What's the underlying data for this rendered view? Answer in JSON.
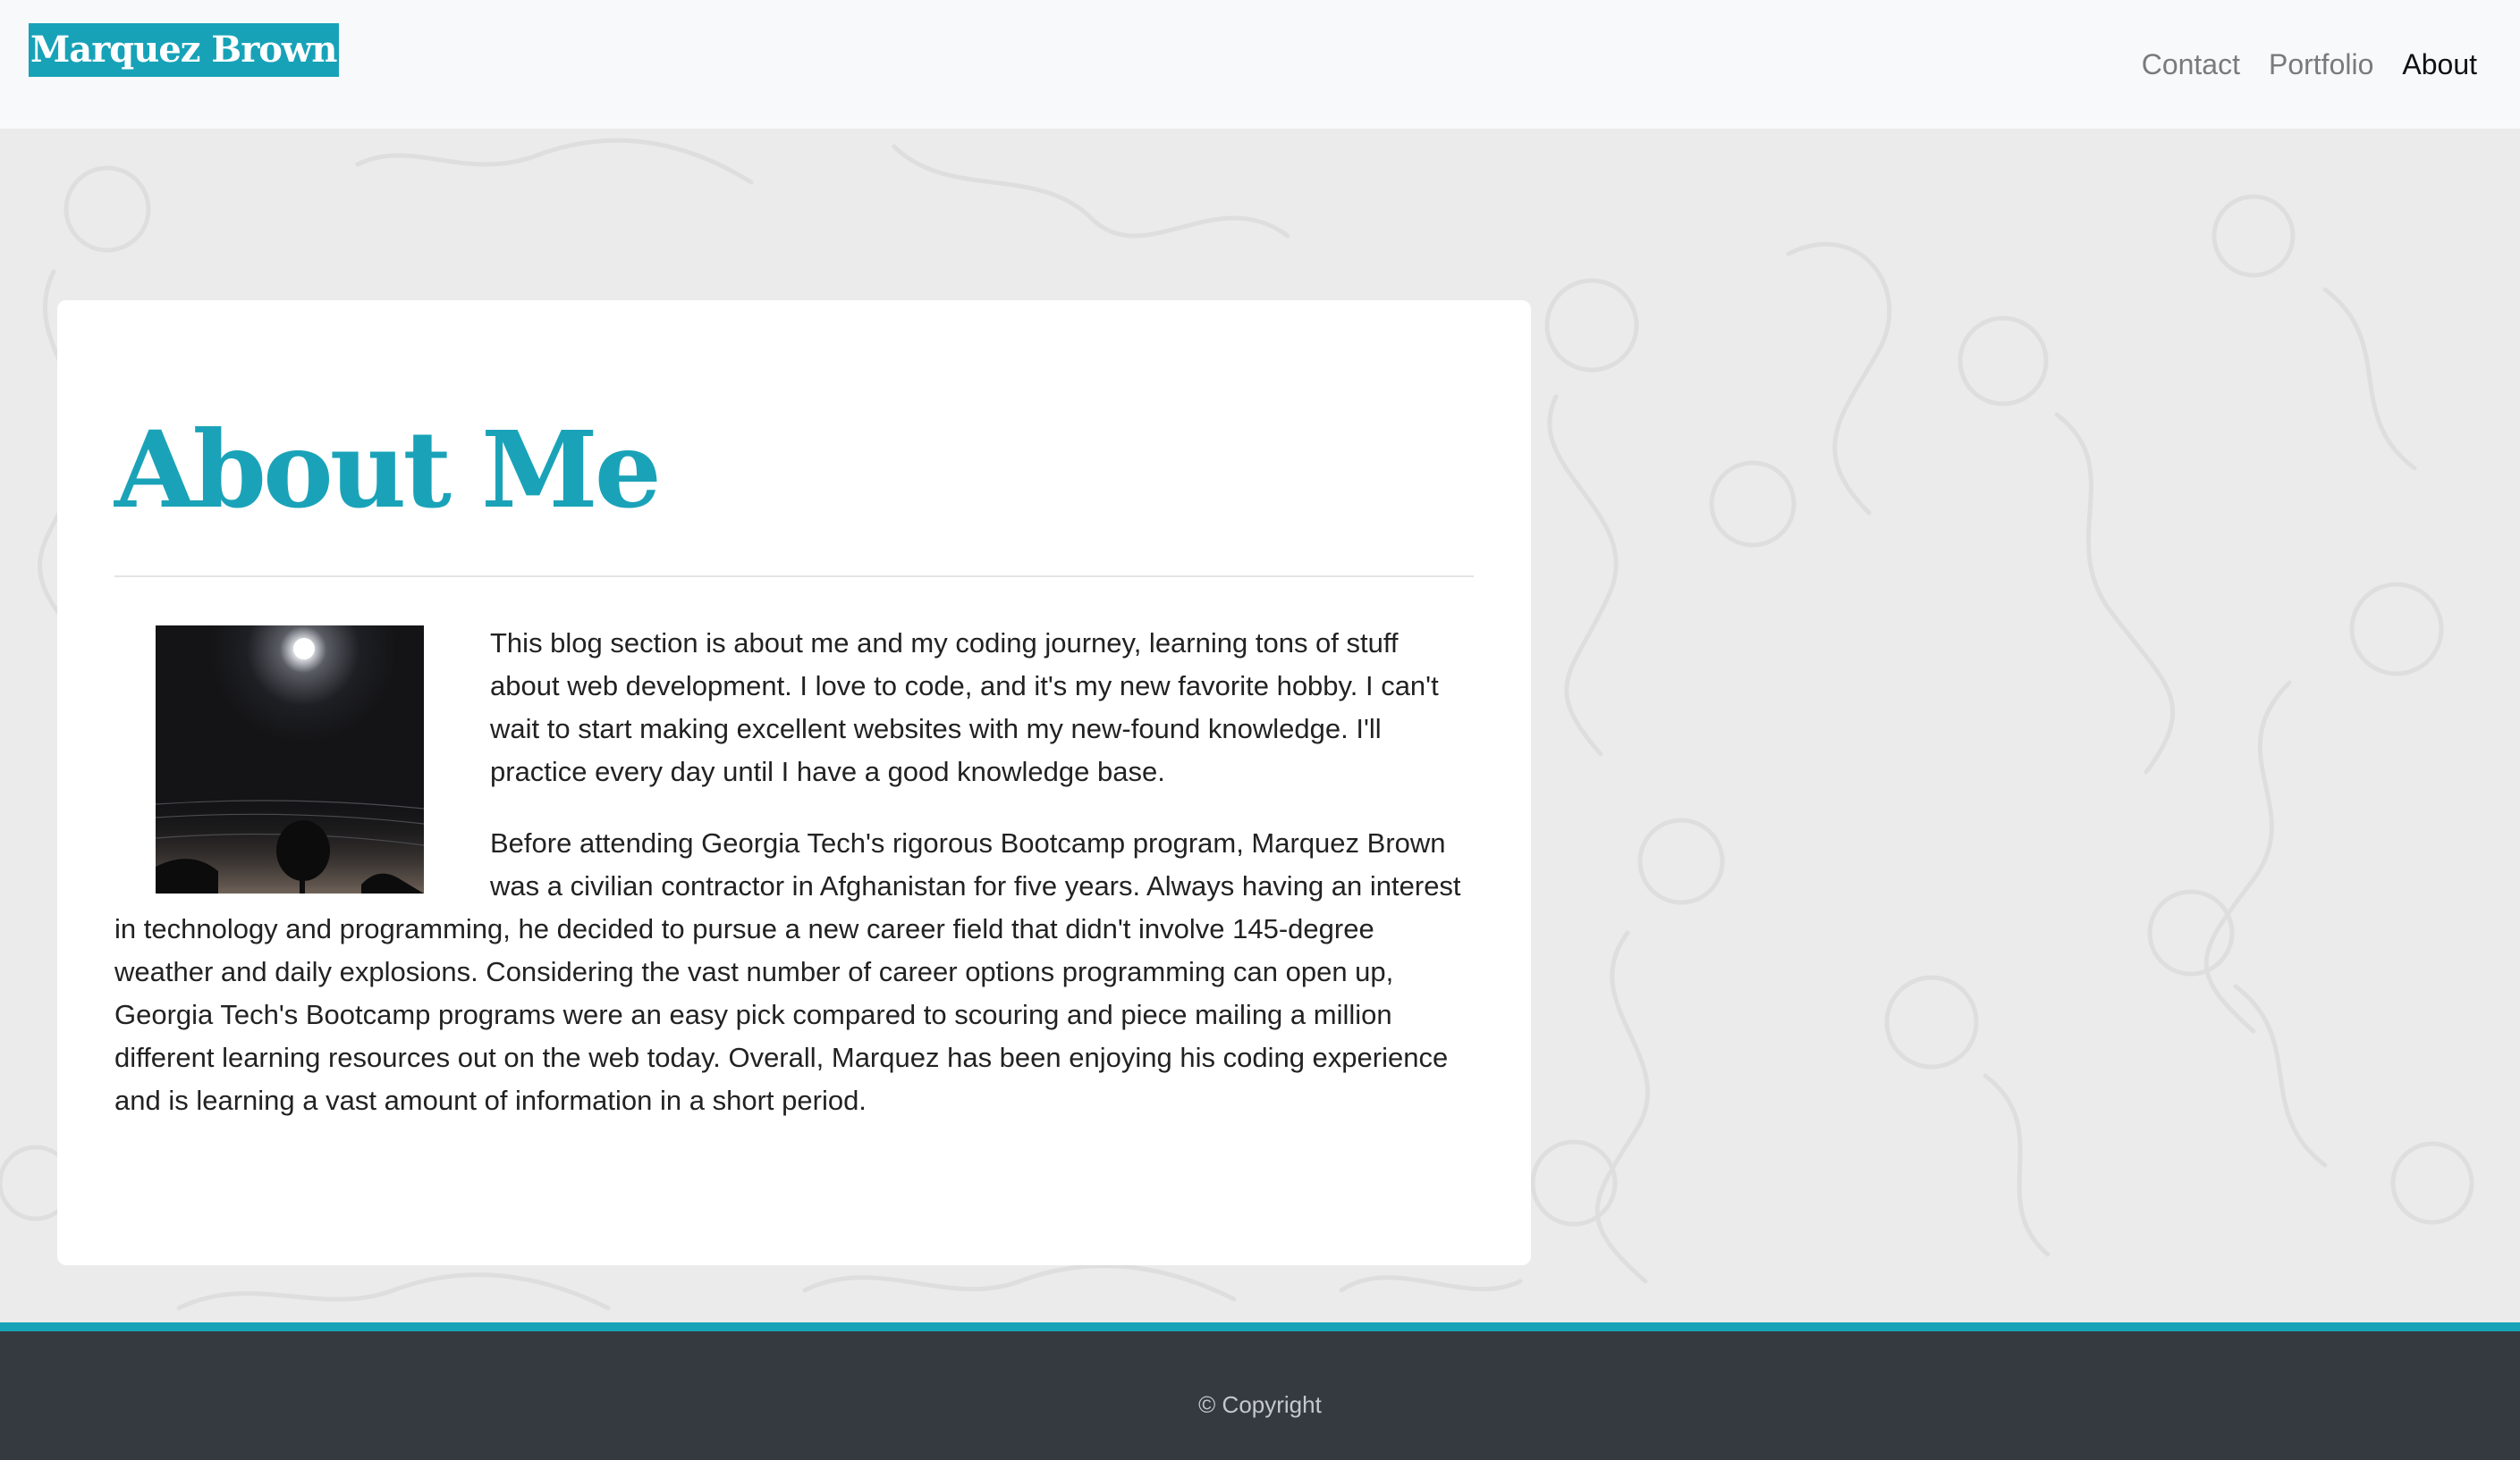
{
  "header": {
    "brand": "Marquez Brown",
    "nav": [
      {
        "label": "Contact"
      },
      {
        "label": "Portfolio"
      },
      {
        "label": "About"
      }
    ],
    "active_nav": "About"
  },
  "about": {
    "title": "About Me",
    "paragraphs": [
      "This blog section is about me and my coding journey, learning tons of stuff about web development. I love to code, and it's my new favorite hobby. I can't wait to start making excellent websites with my new-found knowledge. I'll practice every day until I have a good knowledge base.",
      "Before attending Georgia Tech's rigorous Bootcamp program, Marquez Brown was a civilian contractor in Afghanistan for five years. Always having an interest in technology and programming, he decided to pursue a new career field that didn't involve 145-degree weather and daily explosions. Considering the vast number of career options programming can open up, Georgia Tech's Bootcamp programs were an easy pick compared to scouring and piece mailing a million different learning resources out on the web today. Overall, Marquez has been enjoying his coding experience and is learning a vast amount of information in a short period."
    ]
  },
  "footer": {
    "copyright": "© Copyright"
  },
  "colors": {
    "accent": "#17a2b8",
    "navbar_bg": "#f8f9fa",
    "page_bg": "#ebebeb",
    "footer_bg": "#343a40"
  }
}
